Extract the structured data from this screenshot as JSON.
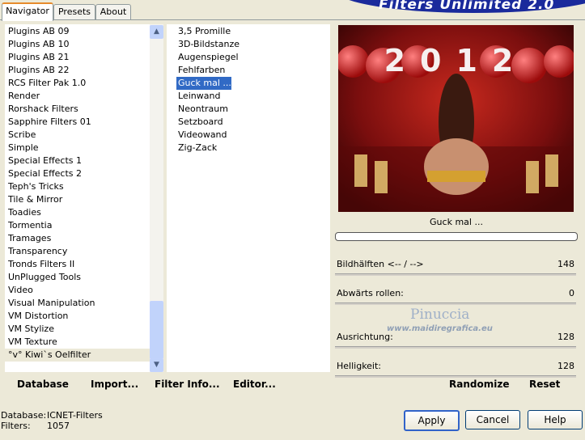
{
  "tabs": [
    {
      "label": "Navigator"
    },
    {
      "label": "Presets"
    },
    {
      "label": "About"
    }
  ],
  "banner": {
    "title": "Filters Unlimited 2.0"
  },
  "categories": [
    "Plugins AB 09",
    "Plugins AB 10",
    "Plugins AB 21",
    "Plugins AB 22",
    "RCS Filter Pak 1.0",
    "Render",
    "Rorshack Filters",
    "Sapphire Filters 01",
    "Scribe",
    "Simple",
    "Special Effects 1",
    "Special Effects 2",
    "Teph's Tricks",
    "Tile & Mirror",
    "Toadies",
    "Tormentia",
    "Tramages",
    "Transparency",
    "Tronds Filters II",
    "UnPlugged Tools",
    "Video",
    "Visual Manipulation",
    "VM Distortion",
    "VM Stylize",
    "VM Texture",
    "°v° Kiwi`s Oelfilter"
  ],
  "filters": [
    "3,5 Promille",
    "3D-Bildstanze",
    "Augenspiegel",
    "Fehlfarben",
    "Guck mal ...",
    "Leinwand",
    "Neontraum",
    "Setzboard",
    "Videowand",
    "Zig-Zack"
  ],
  "selected_filter": "Guck mal ...",
  "toolbar": {
    "database": "Database",
    "import": "Import...",
    "filter_info": "Filter Info...",
    "editor": "Editor..."
  },
  "preview": {
    "filter_name": "Guck mal ...",
    "banner_text": "2012",
    "watermark_name": "Pinuccia",
    "watermark_url": "www.maidiregrafica.eu"
  },
  "params": [
    {
      "label": "Bildhälften <-- / -->",
      "value": "148"
    },
    {
      "label": "Abwärts rollen:",
      "value": "0"
    },
    {
      "label": "Ausrichtung:",
      "value": "128"
    },
    {
      "label": "Helligkeit:",
      "value": "128"
    }
  ],
  "actions": {
    "randomize": "Randomize",
    "reset": "Reset"
  },
  "status": {
    "database_label": "Database:",
    "database_value": "ICNET-Filters",
    "filters_label": "Filters:",
    "filters_value": "1057"
  },
  "buttons": {
    "apply": "Apply",
    "cancel": "Cancel",
    "help": "Help"
  },
  "colors": {
    "selection": "#316ac5",
    "banner": "#1a2a9c",
    "window": "#ece9d8"
  }
}
